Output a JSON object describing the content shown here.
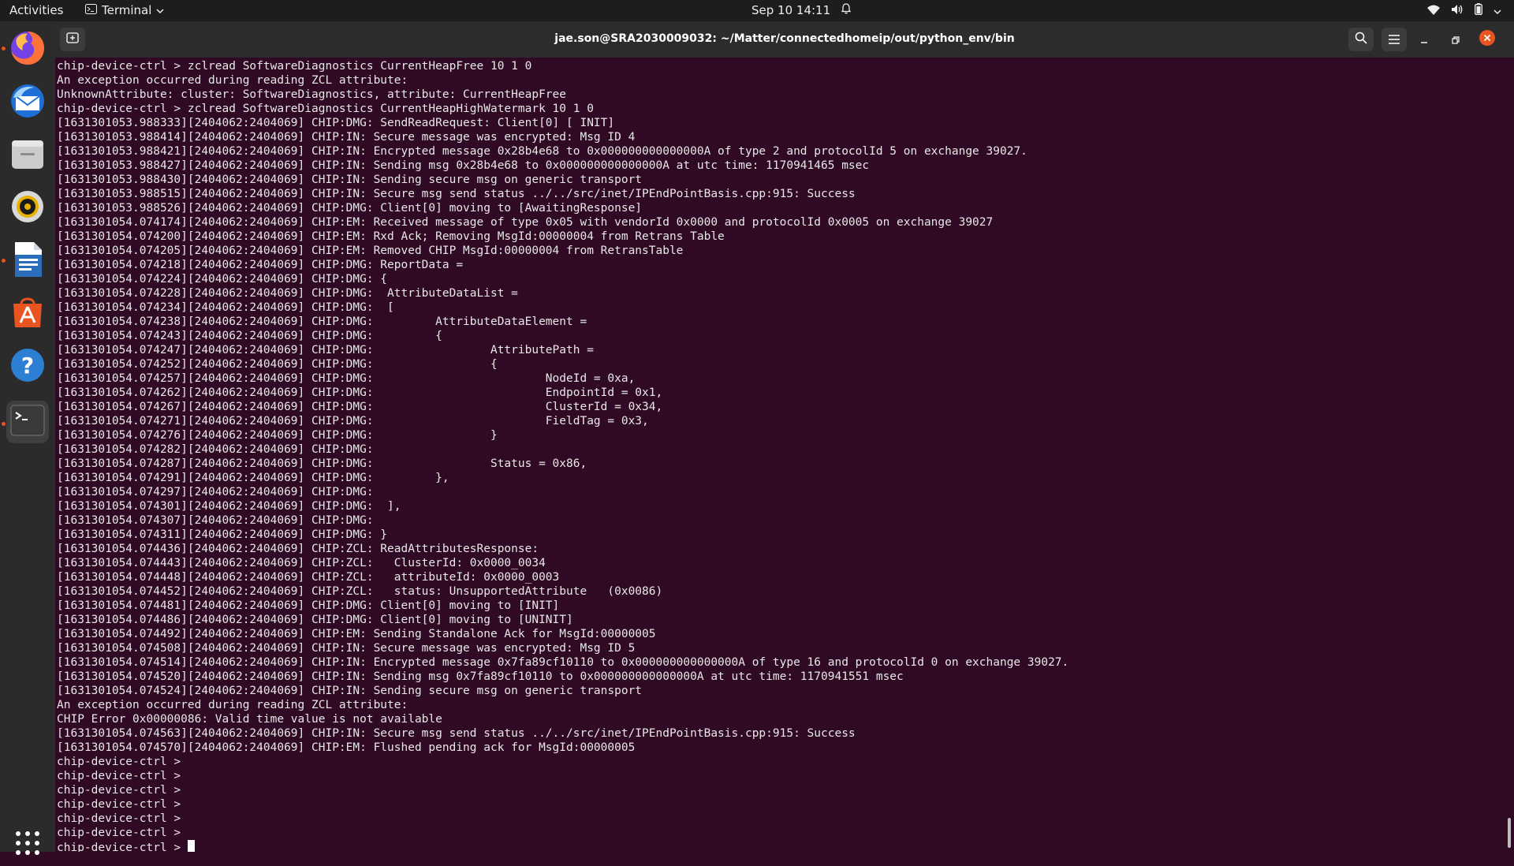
{
  "topbar": {
    "activities": "Activities",
    "app_menu": "Terminal",
    "clock": "Sep 10  14:11"
  },
  "window": {
    "title": "jae.son@SRA2030009032: ~/Matter/connectedhomeip/out/python_env/bin"
  },
  "dock": {
    "items": [
      "firefox-icon",
      "thunderbird-icon",
      "files-icon",
      "rhythmbox-icon",
      "writer-icon",
      "software-icon",
      "help-icon",
      "terminal-icon"
    ]
  },
  "terminal": {
    "lines": [
      "chip-device-ctrl > zclread SoftwareDiagnostics CurrentHeapFree 10 1 0",
      "An exception occurred during reading ZCL attribute:",
      "UnknownAttribute: cluster: SoftwareDiagnostics, attribute: CurrentHeapFree",
      "chip-device-ctrl > zclread SoftwareDiagnostics CurrentHeapHighWatermark 10 1 0",
      "[1631301053.988333][2404062:2404069] CHIP:DMG: SendReadRequest: Client[0] [ INIT]",
      "[1631301053.988414][2404062:2404069] CHIP:IN: Secure message was encrypted: Msg ID 4",
      "[1631301053.988421][2404062:2404069] CHIP:IN: Encrypted message 0x28b4e68 to 0x000000000000000A of type 2 and protocolId 5 on exchange 39027.",
      "[1631301053.988427][2404062:2404069] CHIP:IN: Sending msg 0x28b4e68 to 0x000000000000000A at utc time: 1170941465 msec",
      "[1631301053.988430][2404062:2404069] CHIP:IN: Sending secure msg on generic transport",
      "[1631301053.988515][2404062:2404069] CHIP:IN: Secure msg send status ../../src/inet/IPEndPointBasis.cpp:915: Success",
      "[1631301053.988526][2404062:2404069] CHIP:DMG: Client[0] moving to [AwaitingResponse]",
      "[1631301054.074174][2404062:2404069] CHIP:EM: Received message of type 0x05 with vendorId 0x0000 and protocolId 0x0005 on exchange 39027",
      "[1631301054.074200][2404062:2404069] CHIP:EM: Rxd Ack; Removing MsgId:00000004 from Retrans Table",
      "[1631301054.074205][2404062:2404069] CHIP:EM: Removed CHIP MsgId:00000004 from RetransTable",
      "[1631301054.074218][2404062:2404069] CHIP:DMG: ReportData =",
      "[1631301054.074224][2404062:2404069] CHIP:DMG: {",
      "[1631301054.074228][2404062:2404069] CHIP:DMG:  AttributeDataList =",
      "[1631301054.074234][2404062:2404069] CHIP:DMG:  [",
      "[1631301054.074238][2404062:2404069] CHIP:DMG:         AttributeDataElement =",
      "[1631301054.074243][2404062:2404069] CHIP:DMG:         {",
      "[1631301054.074247][2404062:2404069] CHIP:DMG:                 AttributePath =",
      "[1631301054.074252][2404062:2404069] CHIP:DMG:                 {",
      "[1631301054.074257][2404062:2404069] CHIP:DMG:                         NodeId = 0xa,",
      "[1631301054.074262][2404062:2404069] CHIP:DMG:                         EndpointId = 0x1,",
      "[1631301054.074267][2404062:2404069] CHIP:DMG:                         ClusterId = 0x34,",
      "[1631301054.074271][2404062:2404069] CHIP:DMG:                         FieldTag = 0x3,",
      "[1631301054.074276][2404062:2404069] CHIP:DMG:                 }",
      "[1631301054.074282][2404062:2404069] CHIP:DMG:",
      "[1631301054.074287][2404062:2404069] CHIP:DMG:                 Status = 0x86,",
      "[1631301054.074291][2404062:2404069] CHIP:DMG:         },",
      "[1631301054.074297][2404062:2404069] CHIP:DMG:",
      "[1631301054.074301][2404062:2404069] CHIP:DMG:  ],",
      "[1631301054.074307][2404062:2404069] CHIP:DMG:",
      "[1631301054.074311][2404062:2404069] CHIP:DMG: }",
      "[1631301054.074436][2404062:2404069] CHIP:ZCL: ReadAttributesResponse:",
      "[1631301054.074443][2404062:2404069] CHIP:ZCL:   ClusterId: 0x0000_0034",
      "[1631301054.074448][2404062:2404069] CHIP:ZCL:   attributeId: 0x0000_0003",
      "[1631301054.074452][2404062:2404069] CHIP:ZCL:   status: UnsupportedAttribute   (0x0086)",
      "[1631301054.074481][2404062:2404069] CHIP:DMG: Client[0] moving to [INIT]",
      "[1631301054.074486][2404062:2404069] CHIP:DMG: Client[0] moving to [UNINIT]",
      "[1631301054.074492][2404062:2404069] CHIP:EM: Sending Standalone Ack for MsgId:00000005",
      "[1631301054.074508][2404062:2404069] CHIP:IN: Secure message was encrypted: Msg ID 5",
      "[1631301054.074514][2404062:2404069] CHIP:IN: Encrypted message 0x7fa89cf10110 to 0x000000000000000A of type 16 and protocolId 0 on exchange 39027.",
      "[1631301054.074520][2404062:2404069] CHIP:IN: Sending msg 0x7fa89cf10110 to 0x000000000000000A at utc time: 1170941551 msec",
      "[1631301054.074524][2404062:2404069] CHIP:IN: Sending secure msg on generic transport",
      "An exception occurred during reading ZCL attribute:",
      "CHIP Error 0x00000086: Valid time value is not available",
      "[1631301054.074563][2404062:2404069] CHIP:IN: Secure msg send status ../../src/inet/IPEndPointBasis.cpp:915: Success",
      "[1631301054.074570][2404062:2404069] CHIP:EM: Flushed pending ack for MsgId:00000005",
      "chip-device-ctrl >",
      "chip-device-ctrl >",
      "chip-device-ctrl >",
      "chip-device-ctrl >",
      "chip-device-ctrl >",
      "chip-device-ctrl >"
    ],
    "prompt": "chip-device-ctrl > "
  }
}
